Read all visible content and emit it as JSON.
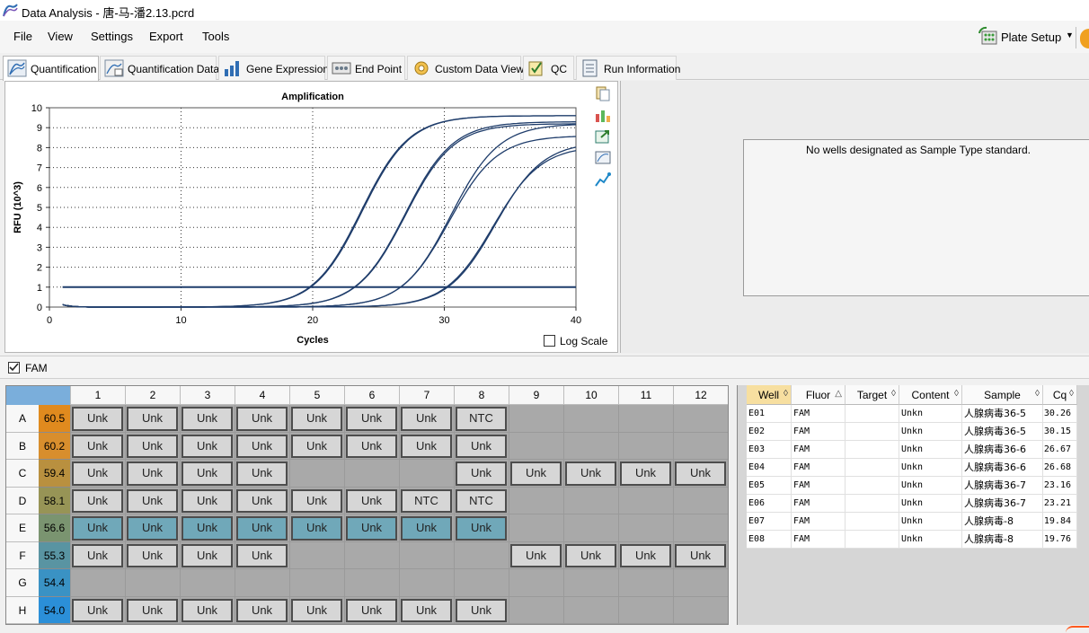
{
  "window": {
    "title": "Data Analysis - 唐-马-潘2.13.pcrd"
  },
  "menu": {
    "items": [
      "File",
      "View",
      "Settings",
      "Export",
      "Tools"
    ]
  },
  "toolbar": {
    "plate_setup_label": "Plate Setup"
  },
  "tabs": [
    {
      "label": "Quantification",
      "icon": "amplification-icon",
      "active": true
    },
    {
      "label": "Quantification Data",
      "icon": "table-chart-icon"
    },
    {
      "label": "Gene Expression",
      "icon": "bar-chart-icon"
    },
    {
      "label": "End Point",
      "icon": "endpoint-icon"
    },
    {
      "label": "Custom Data View",
      "icon": "custom-view-icon"
    },
    {
      "label": "QC",
      "icon": "qc-icon"
    },
    {
      "label": "Run Information",
      "icon": "run-info-icon"
    }
  ],
  "chart_data": {
    "type": "line",
    "title": "Amplification",
    "xlabel": "Cycles",
    "ylabel": "RFU (10^3)",
    "xlim": [
      0,
      40
    ],
    "ylim": [
      0,
      10
    ],
    "xticks": [
      0,
      10,
      20,
      30,
      40
    ],
    "yticks": [
      0,
      1,
      2,
      3,
      4,
      5,
      6,
      7,
      8,
      9,
      10
    ],
    "grid": "dotted",
    "threshold": 1.0,
    "series": [
      {
        "well": "E01",
        "cq": 30.26,
        "plateau": 8.3
      },
      {
        "well": "E02",
        "cq": 30.15,
        "plateau": 8.1
      },
      {
        "well": "E03",
        "cq": 26.67,
        "plateau": 9.2
      },
      {
        "well": "E04",
        "cq": 26.68,
        "plateau": 8.6
      },
      {
        "well": "E05",
        "cq": 23.16,
        "plateau": 9.3
      },
      {
        "well": "E06",
        "cq": 23.21,
        "plateau": 9.2
      },
      {
        "well": "E07",
        "cq": 19.84,
        "plateau": 9.6
      },
      {
        "well": "E08",
        "cq": 19.76,
        "plateau": 9.6
      }
    ],
    "line_color": "#1f3d6b",
    "log_scale_label": "Log Scale",
    "log_scale_checked": false
  },
  "standard_panel": {
    "message": "No wells designated as Sample Type standard."
  },
  "fluor_filter": {
    "label": "FAM",
    "checked": true
  },
  "plate": {
    "columns": [
      "1",
      "2",
      "3",
      "4",
      "5",
      "6",
      "7",
      "8",
      "9",
      "10",
      "11",
      "12"
    ],
    "rows": [
      {
        "label": "A",
        "temp": "60.5",
        "temp_color": "#e08a1e",
        "wells": [
          "Unk",
          "Unk",
          "Unk",
          "Unk",
          "Unk",
          "Unk",
          "Unk",
          "NTC",
          "",
          "",
          "",
          ""
        ]
      },
      {
        "label": "B",
        "temp": "60.2",
        "temp_color": "#d88e2d",
        "wells": [
          "Unk",
          "Unk",
          "Unk",
          "Unk",
          "Unk",
          "Unk",
          "Unk",
          "Unk",
          "",
          "",
          "",
          ""
        ]
      },
      {
        "label": "C",
        "temp": "59.4",
        "temp_color": "#b9903f",
        "wells": [
          "Unk",
          "Unk",
          "Unk",
          "Unk",
          "",
          "",
          "",
          "Unk",
          "Unk",
          "Unk",
          "Unk",
          "Unk"
        ]
      },
      {
        "label": "D",
        "temp": "58.1",
        "temp_color": "#979456",
        "wells": [
          "Unk",
          "Unk",
          "Unk",
          "Unk",
          "Unk",
          "Unk",
          "NTC",
          "NTC",
          "",
          "",
          "",
          ""
        ]
      },
      {
        "label": "E",
        "temp": "56.6",
        "temp_color": "#7a9470",
        "wells": [
          "Unk",
          "Unk",
          "Unk",
          "Unk",
          "Unk",
          "Unk",
          "Unk",
          "Unk",
          "",
          "",
          "",
          ""
        ],
        "selected": true
      },
      {
        "label": "F",
        "temp": "55.3",
        "temp_color": "#5994a2",
        "wells": [
          "Unk",
          "Unk",
          "Unk",
          "Unk",
          "",
          "",
          "",
          "",
          "Unk",
          "Unk",
          "Unk",
          "Unk"
        ]
      },
      {
        "label": "G",
        "temp": "54.4",
        "temp_color": "#3a92c4",
        "wells": [
          "",
          "",
          "",
          "",
          "",
          "",
          "",
          "",
          "",
          "",
          "",
          ""
        ]
      },
      {
        "label": "H",
        "temp": "54.0",
        "temp_color": "#2b8fd8",
        "wells": [
          "Unk",
          "Unk",
          "Unk",
          "Unk",
          "Unk",
          "Unk",
          "Unk",
          "Unk",
          "",
          "",
          "",
          ""
        ]
      }
    ]
  },
  "results": {
    "columns": [
      "Well",
      "Fluor",
      "Target",
      "Content",
      "Sample",
      "Cq"
    ],
    "rows": [
      [
        "E01",
        "FAM",
        "",
        "Unkn",
        "人腺病毒36-5",
        "30.26"
      ],
      [
        "E02",
        "FAM",
        "",
        "Unkn",
        "人腺病毒36-5",
        "30.15"
      ],
      [
        "E03",
        "FAM",
        "",
        "Unkn",
        "人腺病毒36-6",
        "26.67"
      ],
      [
        "E04",
        "FAM",
        "",
        "Unkn",
        "人腺病毒36-6",
        "26.68"
      ],
      [
        "E05",
        "FAM",
        "",
        "Unkn",
        "人腺病毒36-7",
        "23.16"
      ],
      [
        "E06",
        "FAM",
        "",
        "Unkn",
        "人腺病毒36-7",
        "23.21"
      ],
      [
        "E07",
        "FAM",
        "",
        "Unkn",
        "人腺病毒-8",
        "19.84"
      ],
      [
        "E08",
        "FAM",
        "",
        "Unkn",
        "人腺病毒-8",
        "19.76"
      ]
    ]
  }
}
